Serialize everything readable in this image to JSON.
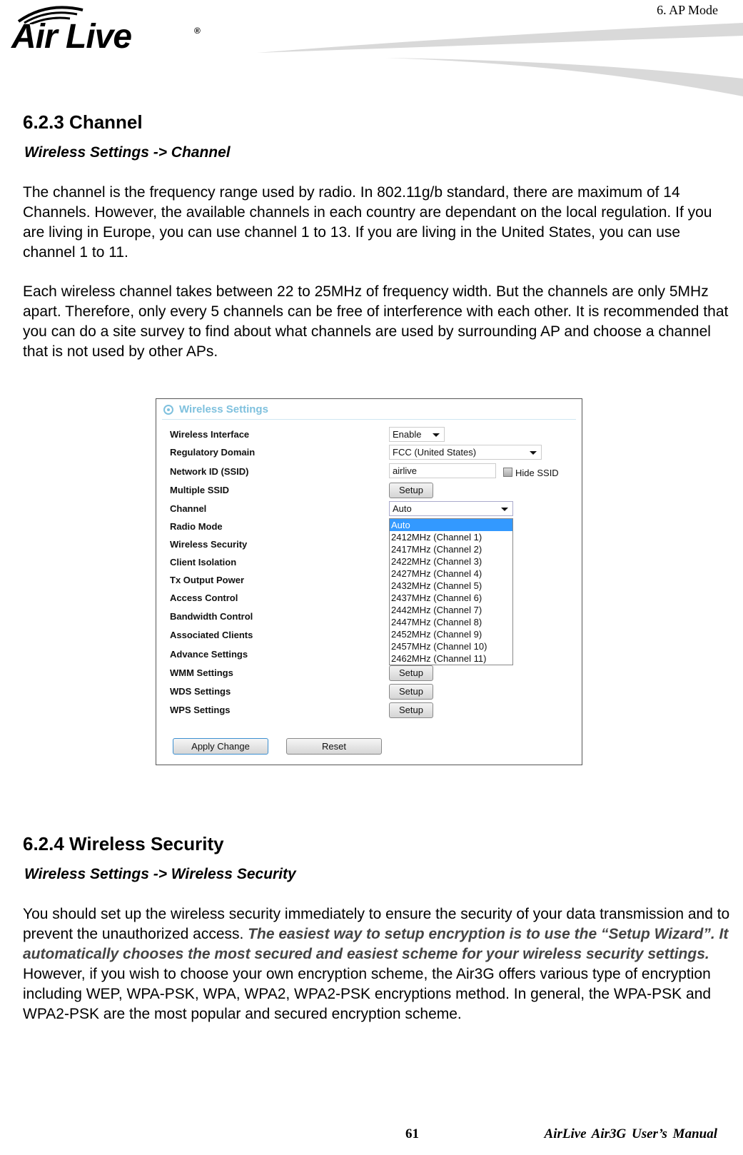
{
  "header": {
    "logo_text": "Air Live",
    "logo_reg": "®",
    "chapter": "6.   AP  Mode"
  },
  "section1": {
    "heading": "6.2.3 Channel",
    "path": "Wireless Settings -> Channel",
    "paragraphs": [
      "The channel is the frequency range used by radio.    In 802.11g/b standard, there are maximum of 14 Channels.    However, the available channels in each country are dependant on the local regulation.    If you are living in Europe, you can use channel 1 to 13.  If you are living in the United States, you can use channel 1 to 11.",
      "Each wireless channel takes between 22 to 25MHz of frequency width.    But the channels are only 5MHz apart.    Therefore, only every 5 channels can be free of interference with each other.    It is recommended that you can do a site survey to find about what channels are used by surrounding AP and choose a channel that is not used by other APs."
    ]
  },
  "screenshot": {
    "title": "Wireless Settings",
    "labels": [
      "Wireless Interface",
      "Regulatory Domain",
      "Network ID (SSID)",
      "Multiple SSID",
      "Channel",
      "Radio Mode",
      "Wireless Security",
      "Client Isolation",
      "Tx Output Power",
      "Access Control",
      "Bandwidth Control",
      "Associated Clients",
      "Advance Settings",
      "WMM Settings",
      "WDS Settings",
      "WPS Settings"
    ],
    "wireless_interface": "Enable",
    "regulatory_domain": "FCC (United States)",
    "ssid_value": "airlive",
    "hide_ssid_label": "Hide SSID",
    "hide_ssid_checked": false,
    "setup_label": "Setup",
    "channel_value": "Auto",
    "channel_options": [
      "Auto",
      "2412MHz (Channel 1)",
      "2417MHz (Channel 2)",
      "2422MHz (Channel 3)",
      "2427MHz (Channel 4)",
      "2432MHz (Channel 5)",
      "2437MHz (Channel 6)",
      "2442MHz (Channel 7)",
      "2447MHz (Channel 8)",
      "2452MHz (Channel 9)",
      "2457MHz (Channel 10)",
      "2462MHz (Channel 11)"
    ],
    "highlighted_option": "Auto",
    "apply_label": "Apply Change",
    "reset_label": "Reset",
    "accent_color": "#7fc1de",
    "highlight_color": "#3399ff"
  },
  "section2": {
    "heading": "6.2.4 Wireless Security",
    "path": "Wireless Settings -> Wireless Security",
    "para_part1": "You should set up the wireless security immediately to ensure the security of your data transmission and to prevent the unauthorized access.    ",
    "para_emphasis": "The easiest way to setup encryption is to use the “Setup Wizard”.    It automatically chooses the most secured and easiest scheme for your wireless security settings.",
    "para_part2": "    However, if you wish to choose your own encryption scheme, the Air3G offers various type of encryption including WEP, WPA-PSK, WPA, WPA2, WPA2-PSK encryptions method.    In general, the WPA-PSK and WPA2-PSK are the most popular and secured encryption scheme."
  },
  "footer": {
    "page_number": "61",
    "manual_title": "AirLive  Air3G  User’s  Manual"
  }
}
